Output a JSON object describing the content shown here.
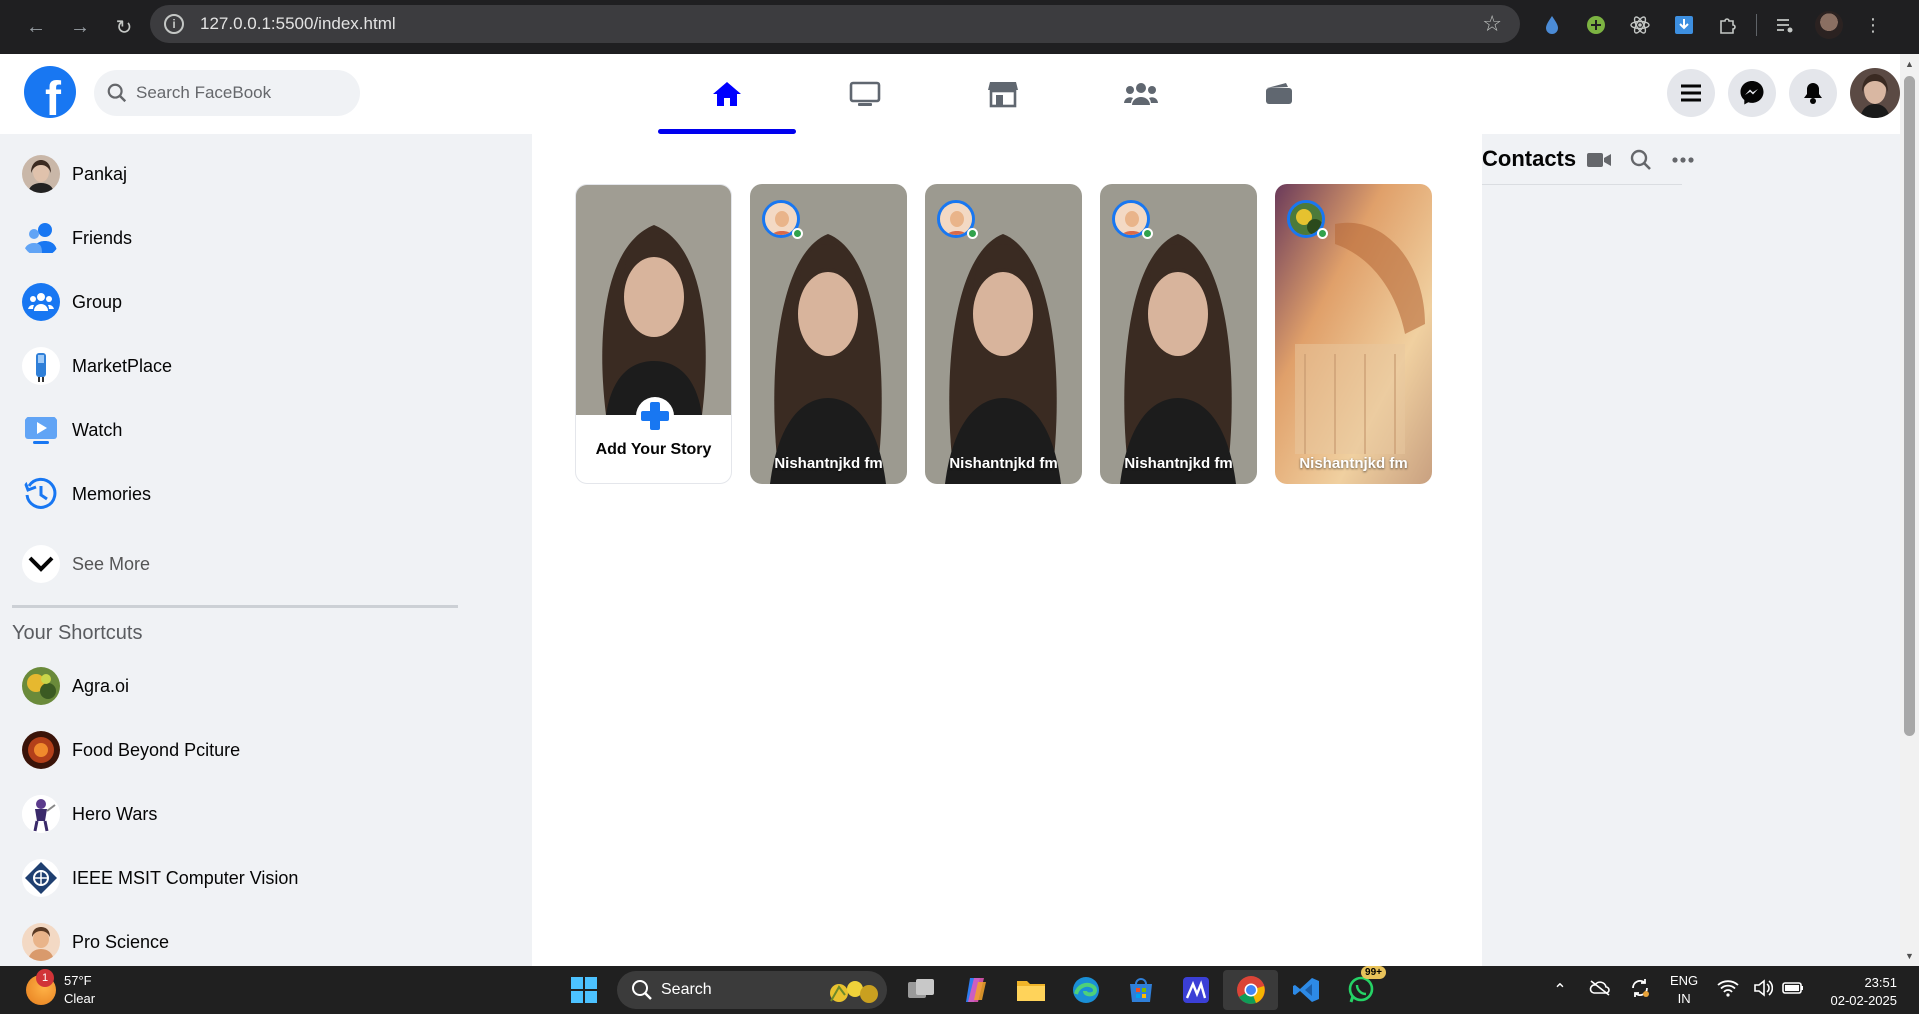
{
  "browser": {
    "url": "127.0.0.1:5500/index.html"
  },
  "header": {
    "logo": "f",
    "search_placeholder": "Search FaceBook"
  },
  "sidebar": {
    "items": [
      {
        "label": "Pankaj",
        "icon": "profile-avatar"
      },
      {
        "label": "Friends",
        "icon": "friends-icon"
      },
      {
        "label": "Group",
        "icon": "group-icon"
      },
      {
        "label": "MarketPlace",
        "icon": "marketplace-icon"
      },
      {
        "label": "Watch",
        "icon": "watch-icon"
      },
      {
        "label": "Memories",
        "icon": "memories-icon"
      }
    ],
    "see_more": "See More",
    "shortcuts_title": "Your Shortcuts",
    "shortcuts": [
      {
        "label": "Agra.oi"
      },
      {
        "label": "Food Beyond Pciture"
      },
      {
        "label": "Hero Wars"
      },
      {
        "label": "IEEE MSIT Computer Vision"
      },
      {
        "label": "Pro Science"
      }
    ]
  },
  "stories": {
    "add_label": "Add Your Story",
    "items": [
      {
        "name": "Nishantnjkd fm"
      },
      {
        "name": "Nishantnjkd fm"
      },
      {
        "name": "Nishantnjkd fm"
      },
      {
        "name": "Nishantnjkd fm"
      }
    ]
  },
  "contacts": {
    "title": "Contacts"
  },
  "taskbar": {
    "weather_badge": "1",
    "temperature": "57°F",
    "condition": "Clear",
    "search_label": "Search",
    "whatsapp_badge": "99+",
    "lang_top": "ENG",
    "lang_bottom": "IN",
    "time": "23:51",
    "date": "02-02-2025"
  },
  "colors": {
    "brand": "#1877f2",
    "active_tab": "#0000ff",
    "online": "#31a24c"
  }
}
